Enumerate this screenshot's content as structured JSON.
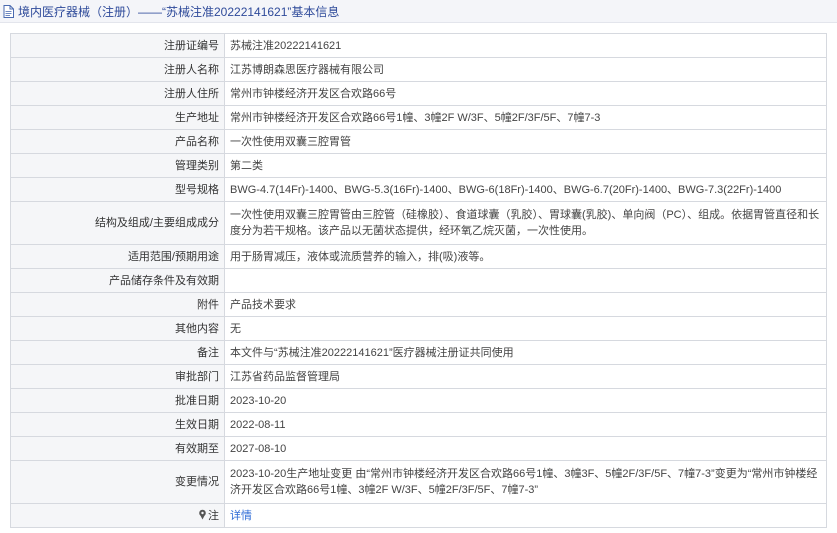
{
  "header": {
    "title": "境内医疗器械（注册）——“苏械注准20222141621”基本信息"
  },
  "rows": [
    {
      "label": "注册证编号",
      "value": "苏械注准20222141621"
    },
    {
      "label": "注册人名称",
      "value": "江苏博朗森思医疗器械有限公司"
    },
    {
      "label": "注册人住所",
      "value": "常州市钟楼经济开发区合欢路66号"
    },
    {
      "label": "生产地址",
      "value": "常州市钟楼经济开发区合欢路66号1幢、3幢2F W/3F、5幢2F/3F/5F、7幢7-3"
    },
    {
      "label": "产品名称",
      "value": "一次性使用双囊三腔胃管"
    },
    {
      "label": "管理类别",
      "value": "第二类"
    },
    {
      "label": "型号规格",
      "value": "BWG-4.7(14Fr)-1400、BWG-5.3(16Fr)-1400、BWG-6(18Fr)-1400、BWG-6.7(20Fr)-1400、BWG-7.3(22Fr)-1400"
    },
    {
      "label": "结构及组成/主要组成成分",
      "value": "一次性使用双囊三腔胃管由三腔管（硅橡胶）、食道球囊（乳胶）、胃球囊(乳胶)、单向阀（PC）、组成。依据胃管直径和长度分为若干规格。该产品以无菌状态提供，经环氧乙烷灭菌，一次性使用。"
    },
    {
      "label": "适用范围/预期用途",
      "value": "用于肠胃减压，液体或流质营养的输入，排(吸)液等。"
    },
    {
      "label": "产品储存条件及有效期",
      "value": ""
    },
    {
      "label": "附件",
      "value": "产品技术要求"
    },
    {
      "label": "其他内容",
      "value": "无"
    },
    {
      "label": "备注",
      "value": "本文件与“苏械注准20222141621”医疗器械注册证共同使用"
    },
    {
      "label": "审批部门",
      "value": "江苏省药品监督管理局"
    },
    {
      "label": "批准日期",
      "value": "2023-10-20"
    },
    {
      "label": "生效日期",
      "value": "2022-08-11"
    },
    {
      "label": "有效期至",
      "value": "2027-08-10"
    },
    {
      "label": "变更情况",
      "value": "2023-10-20生产地址变更 由“常州市钟楼经济开发区合欢路66号1幢、3幢3F、5幢2F/3F/5F、7幢7-3”变更为“常州市钟楼经济开发区合欢路66号1幢、3幢2F W/3F、5幢2F/3F/5F、7幢7-3”"
    }
  ],
  "note_row": {
    "label": "注",
    "link_text": "详情"
  },
  "icons": {
    "header": "document-icon",
    "note": "pin-icon"
  },
  "colors": {
    "header_text": "#2e4a9a",
    "link": "#2e6bd6",
    "label_bg": "#f5f6f8",
    "border": "#d6d9df"
  }
}
